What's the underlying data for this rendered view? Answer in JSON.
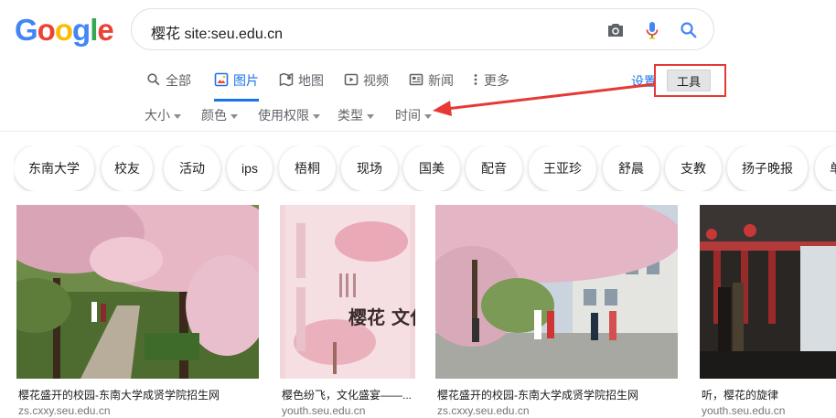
{
  "logo": {
    "letters": [
      "G",
      "o",
      "o",
      "g",
      "l",
      "e"
    ],
    "colors": [
      "#4285F4",
      "#EA4335",
      "#FBBC05",
      "#4285F4",
      "#34A853",
      "#EA4335"
    ]
  },
  "search": {
    "query": "樱花 site:seu.edu.cn"
  },
  "tabs": [
    {
      "label": "全部",
      "icon": "search-icon"
    },
    {
      "label": "图片",
      "icon": "image-icon",
      "active": true
    },
    {
      "label": "地图",
      "icon": "map-icon"
    },
    {
      "label": "视频",
      "icon": "video-icon"
    },
    {
      "label": "新闻",
      "icon": "news-icon"
    },
    {
      "label": "更多",
      "icon": "more-icon"
    }
  ],
  "settings_label": "设置",
  "tools_label": "工具",
  "filters": [
    "大小",
    "颜色",
    "使用权限",
    "类型",
    "时间"
  ],
  "chips": [
    "东南大学",
    "校友",
    "活动",
    "ips",
    "梧桐",
    "现场",
    "国美",
    "配音",
    "王亚珍",
    "舒晨",
    "支教",
    "扬子晚报",
    "单"
  ],
  "results": [
    {
      "caption": "樱花盛开的校园-东南大学成贤学院招生网",
      "source": "zs.cxxy.seu.edu.cn"
    },
    {
      "caption": "樱色纷飞，文化盛宴——...",
      "source": "youth.seu.edu.cn",
      "poster_title": "樱花 文化节"
    },
    {
      "caption": "樱花盛开的校园-东南大学成贤学院招生网",
      "source": "zs.cxxy.seu.edu.cn"
    },
    {
      "caption": "听，樱花的旋律",
      "source": "youth.seu.edu.cn"
    }
  ],
  "colors": {
    "accent": "#1a73e8",
    "annotation": "#e53935"
  }
}
